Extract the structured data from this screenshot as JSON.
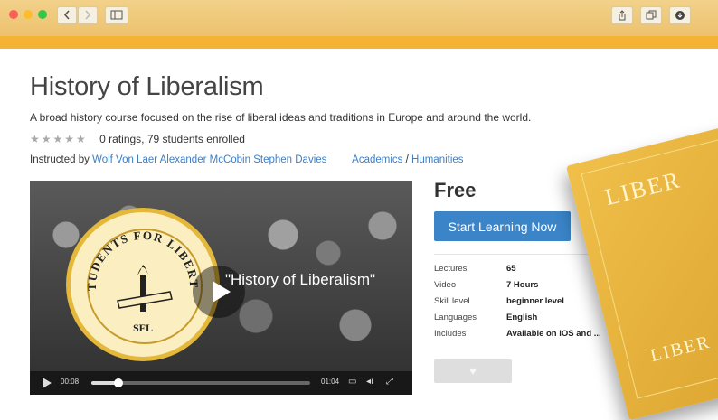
{
  "colors": {
    "accent": "#f5b335",
    "cta": "#3a84c7",
    "link": "#3d7ec3"
  },
  "course": {
    "title": "History of Liberalism",
    "description": "A broad history course focused on the rise of liberal ideas and traditions in Europe and around the world.",
    "stars": "★★★★★",
    "rating_text": "0 ratings, 79 students enrolled",
    "instructed_by_label": "Instructed by",
    "instructors": [
      "Wolf Von Laer",
      "Alexander McCobin",
      "Stephen Davies"
    ],
    "category": "Academics",
    "category_sep": "/",
    "subcategory": "Humanities"
  },
  "video": {
    "seal_top": "STUDENTS FOR LIBERTY",
    "seal_bottom": "SFL",
    "title": "\"History of Liberalism\"",
    "current_time": "00:08",
    "duration": "01:04",
    "progress": 0.125
  },
  "panel": {
    "price": "Free",
    "cta": "Start Learning Now",
    "info": [
      {
        "label": "Lectures",
        "value": "65"
      },
      {
        "label": "Video",
        "value": "7 Hours"
      },
      {
        "label": "Skill level",
        "value": "beginner level"
      },
      {
        "label": "Languages",
        "value": "English"
      },
      {
        "label": "Includes",
        "value": "Available on iOS and ..."
      }
    ]
  },
  "book": {
    "cover_top": "LIBER",
    "cover_bottom": "LIBER"
  }
}
